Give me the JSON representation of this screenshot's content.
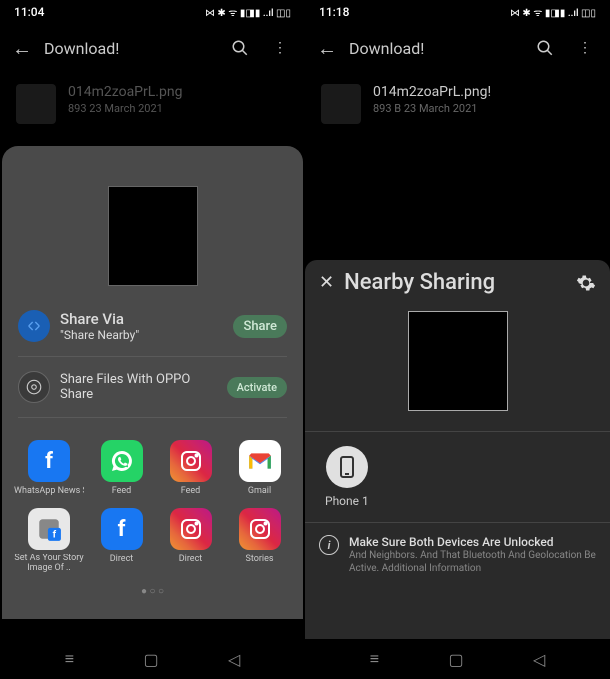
{
  "left": {
    "time": "11:04",
    "header_title": "Download!",
    "file": {
      "name": "014m2zoaPrL.png",
      "meta": "893 23 March 2021"
    },
    "share_via": {
      "title": "Share Via",
      "sub": "\"Share Nearby\"",
      "btn": "Share"
    },
    "oppo": {
      "title": "Share Files With OPPO Share",
      "btn": "Activate"
    },
    "apps": [
      {
        "label": "WhatsApp News Section"
      },
      {
        "label": "Feed"
      },
      {
        "label": "Feed"
      },
      {
        "label": "Gmail"
      },
      {
        "label": "Set As Your Story Image Of .."
      },
      {
        "label": "Direct"
      },
      {
        "label": "Direct"
      },
      {
        "label": "Stories"
      }
    ]
  },
  "right": {
    "time": "11:18",
    "header_title": "Download!",
    "file": {
      "name": "014m2zoaPrL.png!",
      "meta": "893 B 23 March 2021"
    },
    "nearby": {
      "title": "Nearby Sharing",
      "device": "Phone 1",
      "info_title": "Make Sure Both Devices Are Unlocked",
      "info_sub": "And Neighbors. And That Bluetooth And Geolocation Be Active. Additional Information"
    }
  }
}
